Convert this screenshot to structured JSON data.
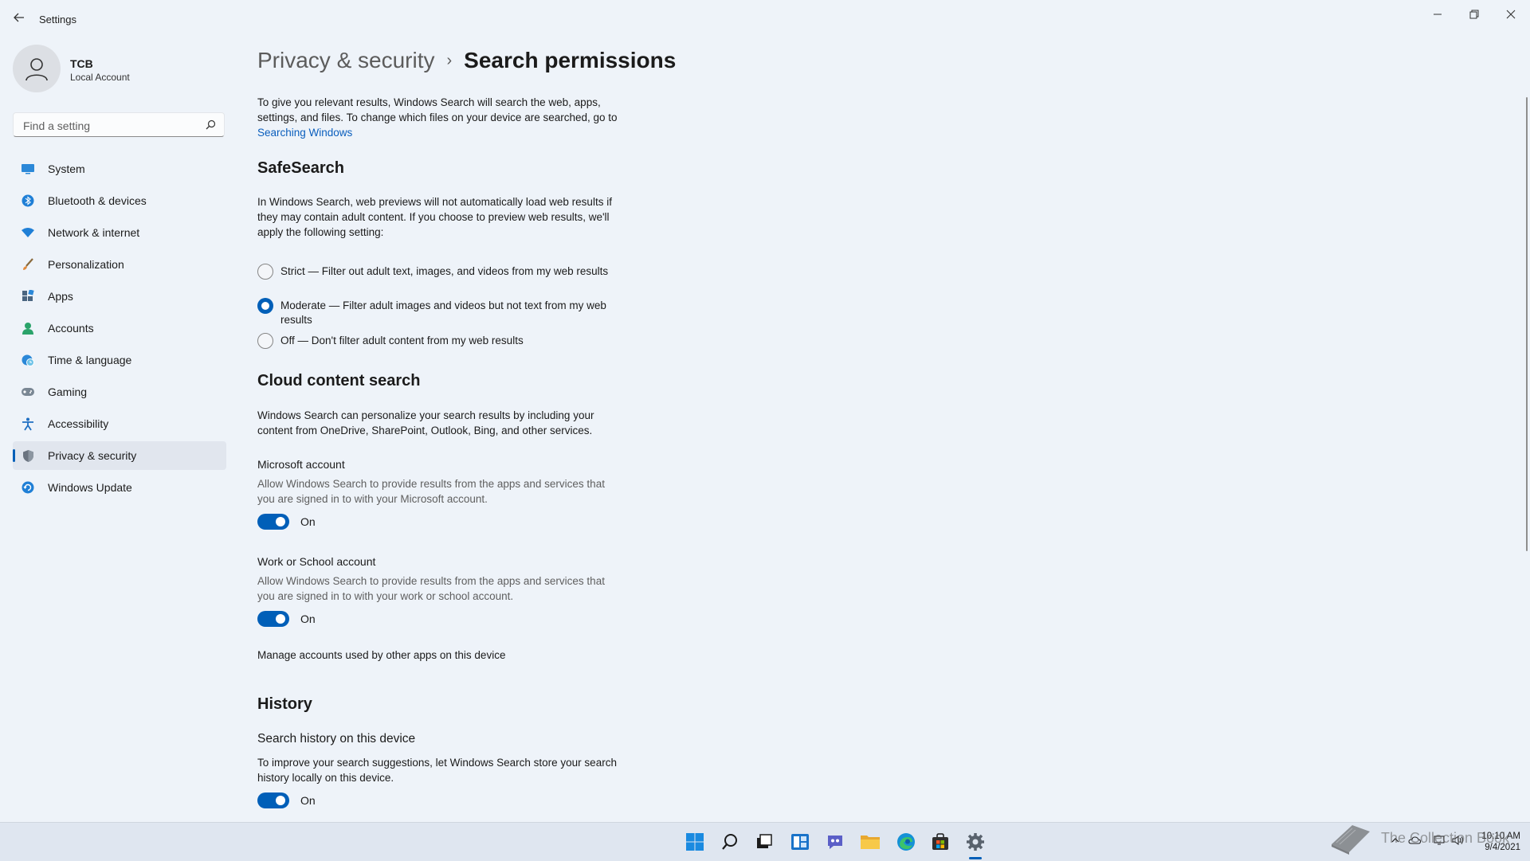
{
  "window": {
    "title": "Settings",
    "back_icon": "back-arrow-icon",
    "controls": [
      "minimize-icon",
      "restore-icon",
      "close-icon"
    ]
  },
  "profile": {
    "name": "TCB",
    "account_type": "Local Account"
  },
  "search": {
    "placeholder": "Find a setting",
    "icon": "search-icon"
  },
  "sidebar": {
    "items": [
      {
        "label": "System",
        "icon": "system-icon",
        "selected": false
      },
      {
        "label": "Bluetooth & devices",
        "icon": "bluetooth-icon",
        "selected": false
      },
      {
        "label": "Network & internet",
        "icon": "wifi-icon",
        "selected": false
      },
      {
        "label": "Personalization",
        "icon": "brush-icon",
        "selected": false
      },
      {
        "label": "Apps",
        "icon": "apps-icon",
        "selected": false
      },
      {
        "label": "Accounts",
        "icon": "person-icon",
        "selected": false
      },
      {
        "label": "Time & language",
        "icon": "globe-clock-icon",
        "selected": false
      },
      {
        "label": "Gaming",
        "icon": "gamepad-icon",
        "selected": false
      },
      {
        "label": "Accessibility",
        "icon": "accessibility-icon",
        "selected": false
      },
      {
        "label": "Privacy & security",
        "icon": "shield-icon",
        "selected": true
      },
      {
        "label": "Windows Update",
        "icon": "update-icon",
        "selected": false
      }
    ]
  },
  "breadcrumb": {
    "parent": "Privacy & security",
    "separator": "›",
    "current": "Search permissions"
  },
  "intro": {
    "text": "To give you relevant results, Windows Search will search the web, apps, settings, and files. To change which files on your device are searched, go to ",
    "link": "Searching Windows"
  },
  "safesearch": {
    "title": "SafeSearch",
    "description": "In Windows Search, web previews will not automatically load web results if they may contain adult content. If you choose to preview web results, we'll apply the following setting:",
    "options": [
      {
        "label": "Strict — Filter out adult text, images, and videos from my web results",
        "checked": false
      },
      {
        "label": "Moderate — Filter adult images and videos but not text from my web results",
        "checked": true
      },
      {
        "label": "Off — Don't filter adult content from my web results",
        "checked": false
      }
    ]
  },
  "cloud": {
    "title": "Cloud content search",
    "description": "Windows Search can personalize your search results by including your content from OneDrive, SharePoint, Outlook, Bing, and other services.",
    "microsoft": {
      "heading": "Microsoft account",
      "description": "Allow Windows Search to provide results from the apps and services that you are signed in to with your Microsoft account.",
      "state": "On"
    },
    "work": {
      "heading": "Work or School account",
      "description": "Allow Windows Search to provide results from the apps and services that you are signed in to with your work or school account.",
      "state": "On"
    },
    "manage_link": "Manage accounts used by other apps on this device"
  },
  "history": {
    "title": "History",
    "heading": "Search history on this device",
    "description": "To improve your search suggestions, let Windows Search store your search history locally on this device.",
    "state": "On"
  },
  "taskbar": {
    "icons": [
      "start-icon",
      "search-icon",
      "task-view-icon",
      "widgets-icon",
      "chat-icon",
      "file-explorer-icon",
      "edge-icon",
      "store-icon",
      "settings-icon"
    ],
    "active": "settings-icon",
    "time": "10:10 AM",
    "date": "9/4/2021",
    "watermark": "The Collection Book"
  },
  "colors": {
    "accent": "#005fb8",
    "link": "#0a5ebd",
    "background": "#eef3f9"
  }
}
